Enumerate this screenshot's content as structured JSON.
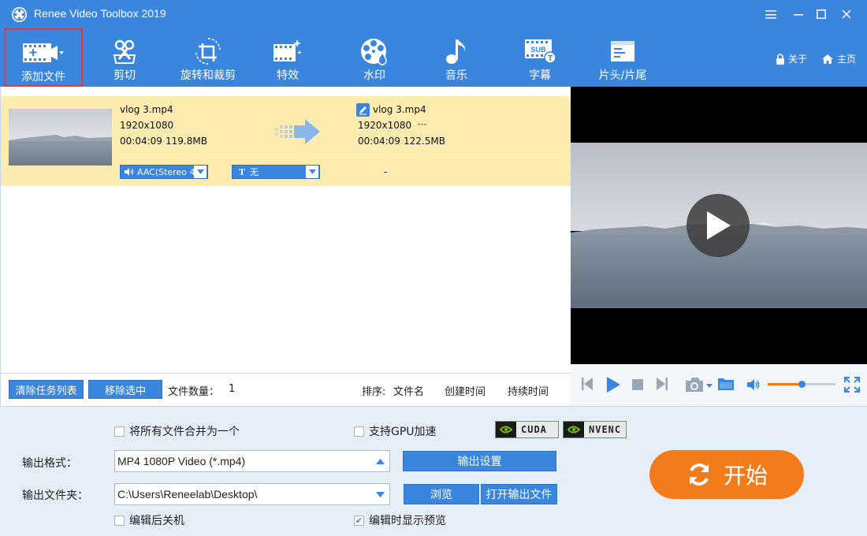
{
  "window": {
    "title": "Renee Video Toolbox 2019"
  },
  "toolbar": {
    "items": [
      {
        "label": "添加文件",
        "icon": "film-add-icon"
      },
      {
        "label": "剪切",
        "icon": "scissors-icon"
      },
      {
        "label": "旋转和裁剪",
        "icon": "rotate-crop-icon"
      },
      {
        "label": "特效",
        "icon": "effects-icon"
      },
      {
        "label": "水印",
        "icon": "watermark-icon"
      },
      {
        "label": "音乐",
        "icon": "music-note-icon"
      },
      {
        "label": "字幕",
        "icon": "subtitle-icon"
      },
      {
        "label": "片头/片尾",
        "icon": "intro-outro-icon"
      }
    ],
    "about": "关于",
    "home": "主页"
  },
  "file": {
    "source": {
      "name": "vlog 3.mp4",
      "resolution": "1920x1080",
      "duration": "00:04:09",
      "size": "119.8MB"
    },
    "output": {
      "name": "vlog 3.mp4",
      "resolution": "1920x1080",
      "more": "···",
      "duration": "00:04:09",
      "size": "122.5MB"
    },
    "audio_track": "AAC(Stereo 4",
    "subtitle": "无",
    "subtitle_prefix": "T",
    "dash": "-"
  },
  "listbar": {
    "clear": "清除任务列表",
    "remove": "移除选中",
    "count_label": "文件数量：",
    "count": "1",
    "sort_label": "排序:",
    "sort_name": "文件名",
    "sort_created": "创建时间",
    "sort_duration": "持续时间"
  },
  "settings": {
    "merge": "将所有文件合并为一个",
    "gpu": "支持GPU加速",
    "cuda": "CUDA",
    "nvenc": "NVENC",
    "format_label": "输出格式：",
    "format_value": "MP4 1080P Video (*.mp4)",
    "output_settings": "输出设置",
    "folder_label": "输出文件夹：",
    "folder_value": "C:\\Users\\Reneelab\\Desktop\\",
    "browse": "浏览",
    "open_output": "打开输出文件",
    "shutdown": "编辑后关机",
    "show_preview": "编辑时显示预览",
    "show_preview_checked": true,
    "start": "开始"
  },
  "player": {
    "volume": 0.5
  },
  "colors": {
    "accent": "#3a86de",
    "start": "#f27c1c",
    "row": "#fcecb0"
  }
}
